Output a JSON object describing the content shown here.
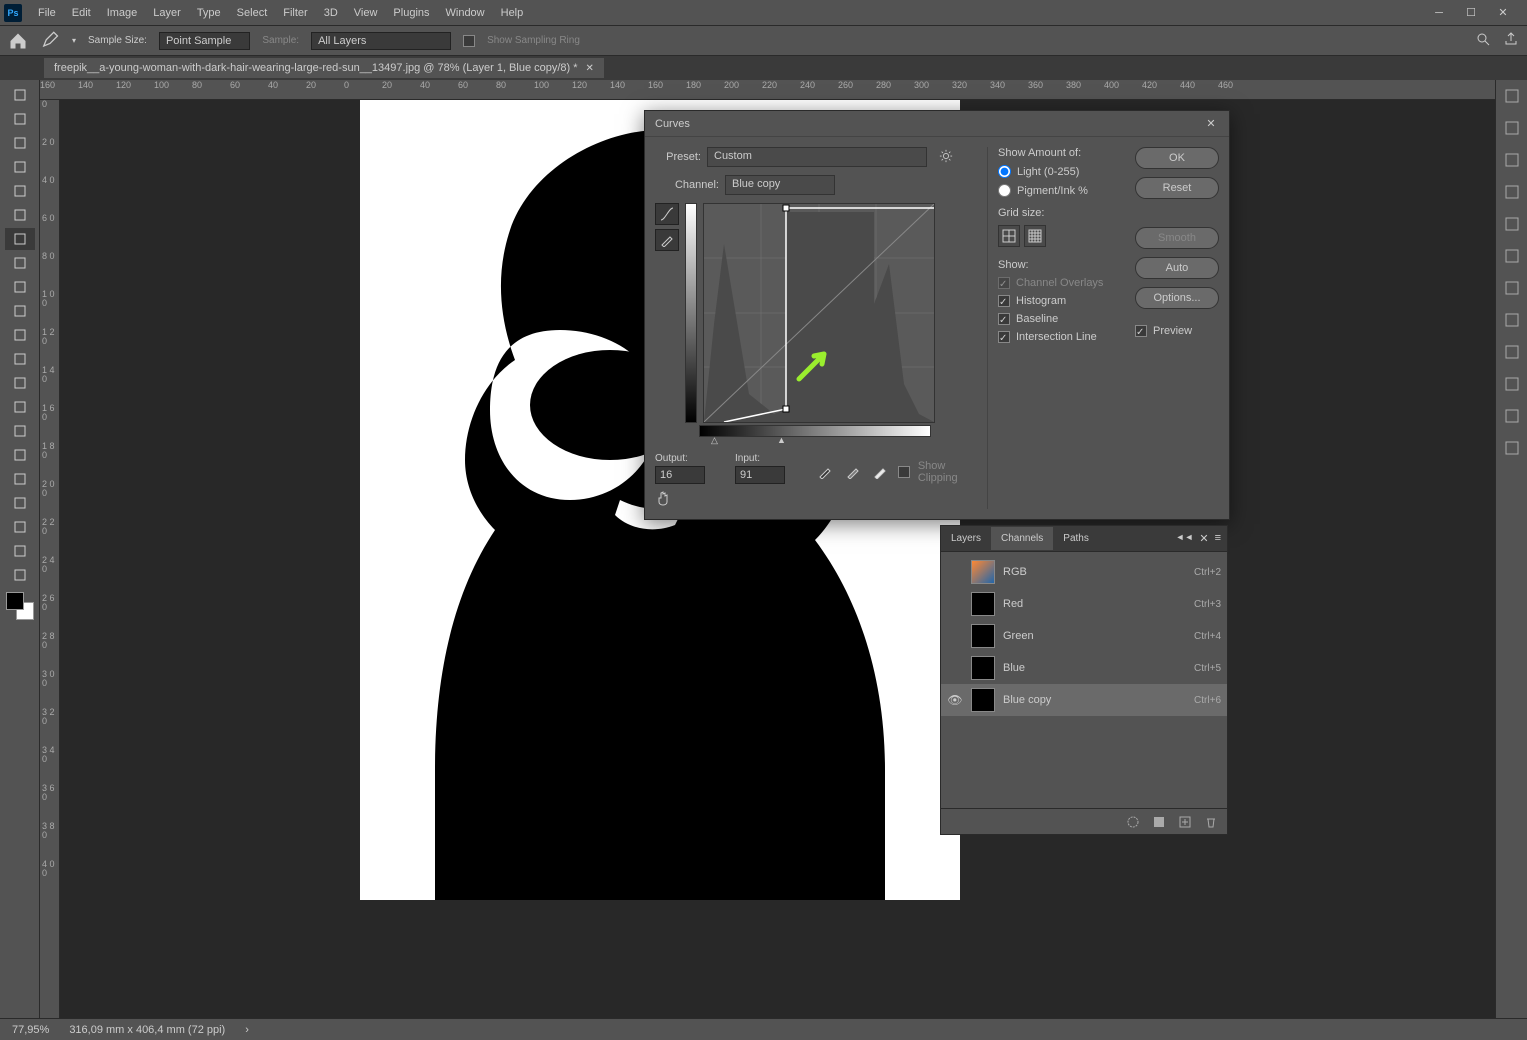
{
  "menu": [
    "File",
    "Edit",
    "Image",
    "Layer",
    "Type",
    "Select",
    "Filter",
    "3D",
    "View",
    "Plugins",
    "Window",
    "Help"
  ],
  "options": {
    "sample_size_label": "Sample Size:",
    "sample_size_value": "Point Sample",
    "sample_label": "Sample:",
    "sample_value": "All Layers",
    "show_ring": "Show Sampling Ring"
  },
  "doc_tab": "freepik__a-young-woman-with-dark-hair-wearing-large-red-sun__13497.jpg @ 78% (Layer 1, Blue copy/8) *",
  "ruler_h": [
    "160",
    "140",
    "120",
    "100",
    "80",
    "60",
    "40",
    "20",
    "0",
    "20",
    "40",
    "60",
    "80",
    "100",
    "120",
    "140",
    "160",
    "180",
    "200",
    "220",
    "240",
    "260",
    "280",
    "300",
    "320",
    "340",
    "360",
    "380",
    "400",
    "420",
    "440",
    "460"
  ],
  "ruler_v": [
    "0",
    "20",
    "40",
    "60",
    "80",
    "100",
    "120",
    "140",
    "160",
    "180",
    "200",
    "220",
    "240",
    "260",
    "280",
    "300",
    "320",
    "340",
    "360",
    "380",
    "400"
  ],
  "dialog": {
    "title": "Curves",
    "preset_label": "Preset:",
    "preset_value": "Custom",
    "channel_label": "Channel:",
    "channel_value": "Blue copy",
    "output_label": "Output:",
    "output_value": "16",
    "input_label": "Input:",
    "input_value": "91",
    "show_clipping": "Show Clipping",
    "show_amount": "Show Amount of:",
    "light": "Light  (0-255)",
    "pigment": "Pigment/Ink %",
    "grid_label": "Grid size:",
    "show_label": "Show:",
    "ch_overlays": "Channel Overlays",
    "histogram": "Histogram",
    "baseline": "Baseline",
    "intersection": "Intersection Line",
    "ok": "OK",
    "reset": "Reset",
    "smooth": "Smooth",
    "auto": "Auto",
    "options": "Options...",
    "preview": "Preview"
  },
  "channels": {
    "tabs": [
      "Layers",
      "Channels",
      "Paths"
    ],
    "rows": [
      {
        "name": "RGB",
        "key": "Ctrl+2",
        "eye": false,
        "thumb": "rgb"
      },
      {
        "name": "Red",
        "key": "Ctrl+3",
        "eye": false,
        "thumb": "bw"
      },
      {
        "name": "Green",
        "key": "Ctrl+4",
        "eye": false,
        "thumb": "bw"
      },
      {
        "name": "Blue",
        "key": "Ctrl+5",
        "eye": false,
        "thumb": "bw"
      },
      {
        "name": "Blue copy",
        "key": "Ctrl+6",
        "eye": true,
        "thumb": "bw",
        "selected": true
      }
    ]
  },
  "status": {
    "zoom": "77,95%",
    "dims": "316,09 mm x 406,4 mm (72 ppi)"
  }
}
